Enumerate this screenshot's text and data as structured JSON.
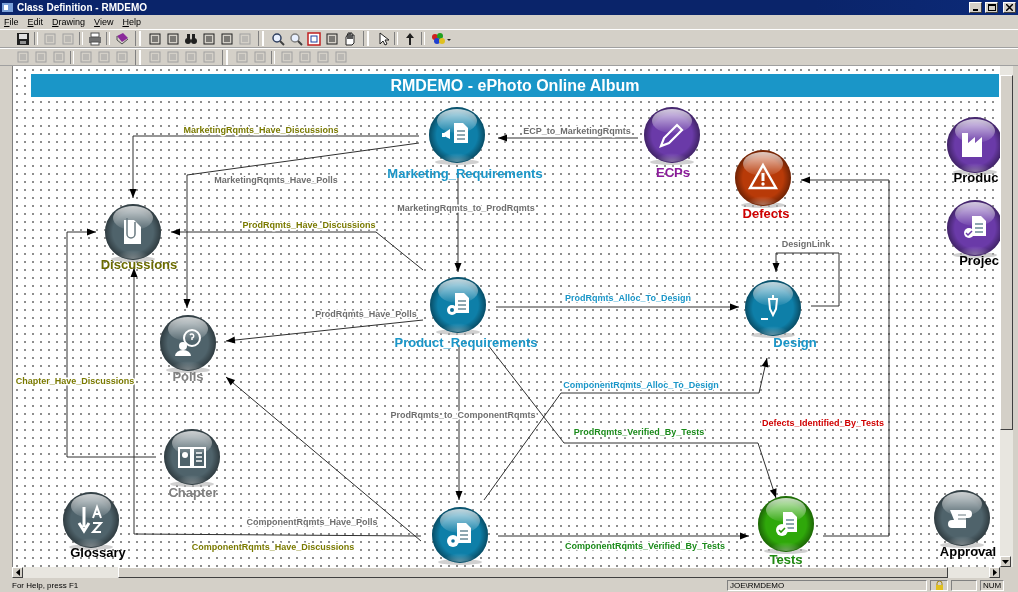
{
  "window": {
    "title": "Class Definition - RMDEMO"
  },
  "menu": [
    "File",
    "Edit",
    "Drawing",
    "View",
    "Help"
  ],
  "diagram": {
    "title": "RMDEMO - ePhoto Online Album",
    "nodes": [
      {
        "label": "Marketing_Requirements",
        "kind": "megaphone-document",
        "color": "#0e7fa8"
      },
      {
        "label": "ECPs",
        "kind": "pencil",
        "color": "#6a3aa8"
      },
      {
        "label": "Produc",
        "kind": "factory",
        "color": "#6a3aa8"
      },
      {
        "label": "Defects",
        "kind": "warning",
        "color": "#b83a08"
      },
      {
        "label": "Projec",
        "kind": "checklist-document",
        "color": "#6a3aa8"
      },
      {
        "label": "Discussions",
        "kind": "paperclip-document",
        "color": "#4f636b"
      },
      {
        "label": "Product_Requirements",
        "kind": "gear-document",
        "color": "#0e7fa8"
      },
      {
        "label": "Design",
        "kind": "pen-nib",
        "color": "#0e7fa8"
      },
      {
        "label": "Polls",
        "kind": "question-person",
        "color": "#4f636b"
      },
      {
        "label": "Chapter",
        "kind": "book",
        "color": "#4f636b"
      },
      {
        "label": "Glossary",
        "kind": "az-sort",
        "color": "#4f636b"
      },
      {
        "kind": "disc-document",
        "color": "#0e7fa8"
      },
      {
        "label": "Tests",
        "kind": "check-document",
        "color": "#2fa80a"
      },
      {
        "label": "Approval",
        "kind": "scroll",
        "color": "#4f636b"
      }
    ],
    "links": [
      {
        "label": "MarketingRqmts_Have_Discussions",
        "color": "#7a7a00"
      },
      {
        "label": "MarketingRqmts_Have_Polls",
        "color": "#6e6e6e"
      },
      {
        "label": "ECP_to_MarketingRqmts",
        "color": "#6e6e6e"
      },
      {
        "label": "MarketingRqmts_to_ProdRqmts",
        "color": "#6e6e6e"
      },
      {
        "label": "ProdRqmts_Have_Discussions",
        "color": "#7a7a00"
      },
      {
        "label": "ProdRqmts_Have_Polls",
        "color": "#6e6e6e"
      },
      {
        "label": "ProdRqmts_Alloc_To_Design",
        "color": "#1a96c8"
      },
      {
        "label": "DesignLink",
        "color": "#6e6e6e"
      },
      {
        "label": "ProdRqmts_to_ComponentRqmts",
        "color": "#6e6e6e"
      },
      {
        "label": "ComponentRqmts_Alloc_To_Design",
        "color": "#1a96c8"
      },
      {
        "label": "ProdRqmts_Verified_By_Tests",
        "color": "#1a8a1a"
      },
      {
        "label": "Defects_Identified_By_Tests",
        "color": "#d00000"
      },
      {
        "label": "Chapter_Have_Discussions",
        "color": "#7a7a00"
      },
      {
        "label": "ComponentRqmts_Have_Discussions",
        "color": "#7a7a00"
      },
      {
        "label": "ComponentRqmts_Have_Polls",
        "color": "#6e6e6e"
      },
      {
        "label": "ComponentRqmts_Verified_By_Tests",
        "color": "#1a8a1a"
      }
    ]
  },
  "status_bar": {
    "hint": "For Help, press F1",
    "user": "JOE\\RMDEMO",
    "num": "NUM"
  }
}
